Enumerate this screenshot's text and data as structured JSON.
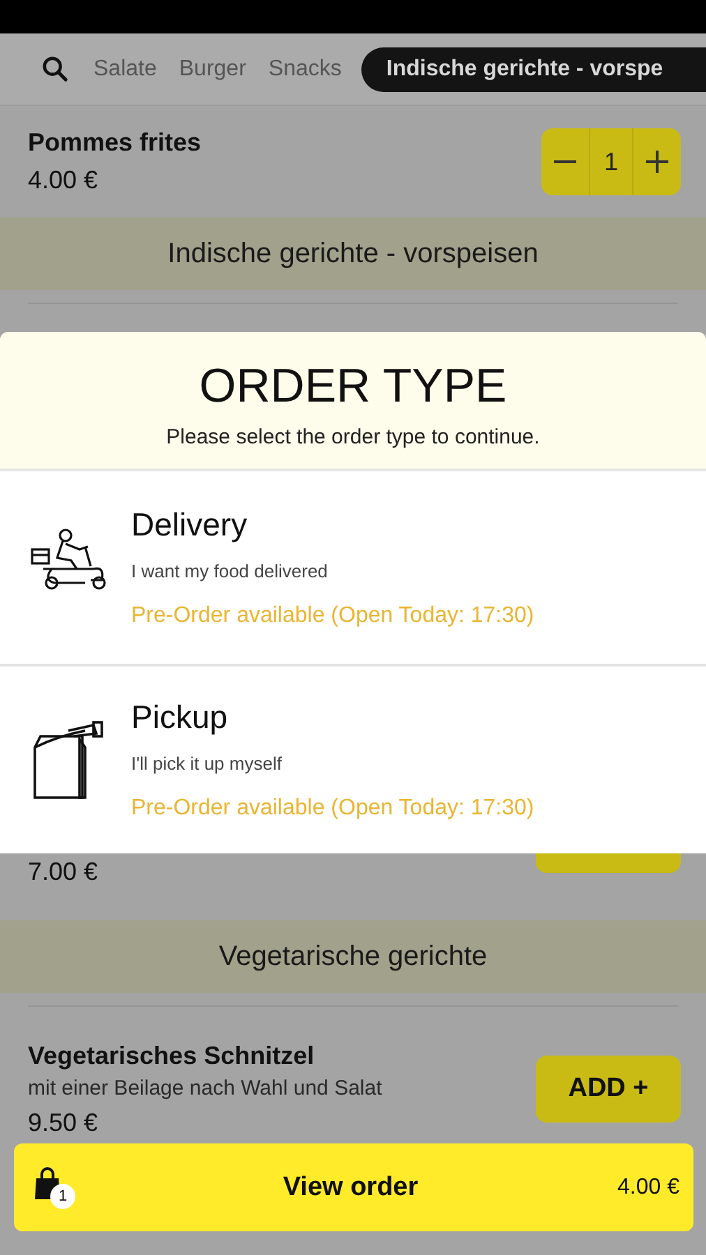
{
  "category_tabs": [
    {
      "label": "Salate",
      "selected": false
    },
    {
      "label": "Burger",
      "selected": false
    },
    {
      "label": "Snacks",
      "selected": false
    },
    {
      "label": "Indische gerichte - vorspe",
      "selected": true
    }
  ],
  "menu": [
    {
      "kind": "item",
      "name": "Pommes frites",
      "price": "4.00 €",
      "quantity": "1"
    },
    {
      "kind": "section",
      "title": "Indische gerichte - vorspeisen"
    },
    {
      "kind": "covered",
      "price": "7.00 €"
    },
    {
      "kind": "section",
      "title": "Vegetarische gerichte"
    },
    {
      "kind": "item",
      "name": "Vegetarisches Schnitzel",
      "description": "mit einer Beilage nach Wahl und Salat",
      "price": "9.50 €",
      "action": "ADD +"
    }
  ],
  "order_type_dialog": {
    "title": "ORDER TYPE",
    "subtitle": "Please select the order type to continue.",
    "options": [
      {
        "kind": "delivery",
        "title": "Delivery",
        "description": "I want my food delivered",
        "availability": "Pre-Order available (Open Today: 17:30)"
      },
      {
        "kind": "pickup",
        "title": "Pickup",
        "description": "I'll pick it up myself",
        "availability": "Pre-Order available (Open Today: 17:30)"
      }
    ]
  },
  "cart_bar": {
    "count": "1",
    "label": "View order",
    "total": "4.00 €"
  }
}
